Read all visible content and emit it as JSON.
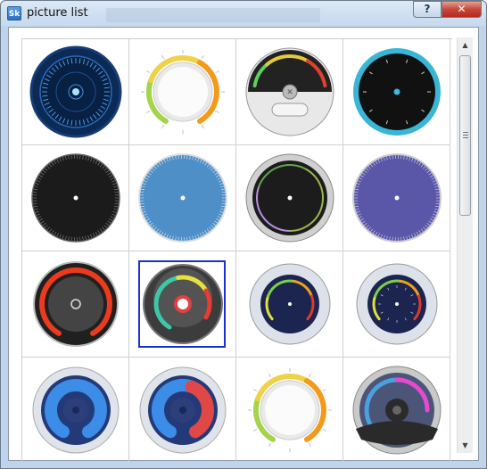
{
  "window": {
    "title": "picture list",
    "app_icon_text": "Sk",
    "help_label": "?",
    "close_label": "✕"
  },
  "scrollbar": {
    "up": "▲",
    "down": "▼"
  },
  "colors": {
    "selection": "#1a2fd6",
    "close": "#c6473a"
  },
  "gauges": [
    {
      "style": "dark-blue-hud",
      "selected": false
    },
    {
      "style": "white-knob-yellow-arc",
      "selected": false
    },
    {
      "style": "half-dark-dial",
      "selected": false
    },
    {
      "style": "black-cyan-ring",
      "selected": false
    },
    {
      "style": "black-tick-dial",
      "selected": false
    },
    {
      "style": "light-blue-dial",
      "selected": false
    },
    {
      "style": "dark-rainbow-ring",
      "selected": false
    },
    {
      "style": "purple-dial",
      "selected": false
    },
    {
      "style": "red-arc-dial",
      "selected": false
    },
    {
      "style": "teal-rainbow-dial",
      "selected": true
    },
    {
      "style": "navy-rainbow-ring",
      "selected": false
    },
    {
      "style": "navy-rainbow-ring-2",
      "selected": false
    },
    {
      "style": "blue-arc-dial",
      "selected": false
    },
    {
      "style": "blue-red-arc-dial",
      "selected": false
    },
    {
      "style": "white-knob-yellow-arc",
      "selected": false
    },
    {
      "style": "gray-speedometer",
      "selected": false
    }
  ]
}
